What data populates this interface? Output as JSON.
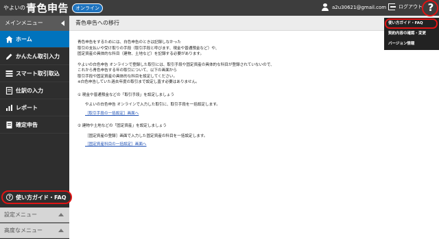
{
  "header": {
    "logo_prefix": "やよいの",
    "logo_main": "青色申告",
    "badge": "オンライン",
    "user_email": "a2u30621@gmail.com",
    "logout_label": "ログアウト",
    "help_label": "?"
  },
  "sidebar": {
    "title": "メインメニュー",
    "items": [
      {
        "label": "ホーム",
        "icon": "home-icon"
      },
      {
        "label": "かんたん取引入力",
        "icon": "pencil-icon"
      },
      {
        "label": "スマート取引取込",
        "icon": "import-icon"
      },
      {
        "label": "仕訳の入力",
        "icon": "journal-icon"
      },
      {
        "label": "レポート",
        "icon": "chart-icon"
      },
      {
        "label": "確定申告",
        "icon": "document-icon"
      }
    ],
    "faq_label": "使い方ガイド・FAQ",
    "sub_menus": [
      {
        "label": "設定メニュー"
      },
      {
        "label": "高度なメニュー"
      }
    ]
  },
  "main": {
    "title": "青色申告への移行",
    "para1": [
      "青色申告をするためには、白色申告のときは記録しなかった",
      "取引の支払いや受け取りの手段（取引手段と呼びます、現金や普通預金など）や、",
      "固定資産の具体的な科目（建物、土地など）を記録する必要があります。"
    ],
    "para2": [
      "やよいの白色申告 オンラインで登録した取引には、取引手段や固定資産の具体的な科目が登録されていないので、",
      "これから青色申告する年の取引について、以下の画面から",
      "取引手段や固定資産の具体的な科目を設定してください。",
      "※白色申告していた過去年度の取引まで設定し直す必要はありません。"
    ],
    "step1": {
      "heading": "① 現金や普通預金などの「取引手段」を設定しましょう",
      "desc": "やよいの白色申告 オンラインで入力した取引に、取引手段を一括設定します。",
      "link": "［取引手段の一括設定］画面へ"
    },
    "step2": {
      "heading": "② 建物や土地などの「固定資産」を設定しましょう",
      "desc": "［固定資産の登録］画面で入力した固定資産の科目を一括設定します。",
      "link": "［固定資産科目の一括設定］画面へ"
    }
  },
  "dropdown": {
    "items": [
      {
        "label": "使い方ガイド・FAQ"
      },
      {
        "label": "契約内容の確認・変更"
      },
      {
        "label": "バージョン情報"
      }
    ]
  },
  "colors": {
    "topbar": "#3d3d3d",
    "sidebar": "#2e2e2e",
    "active": "#0073bd",
    "highlight": "#e01414",
    "link": "#1a4db3"
  }
}
